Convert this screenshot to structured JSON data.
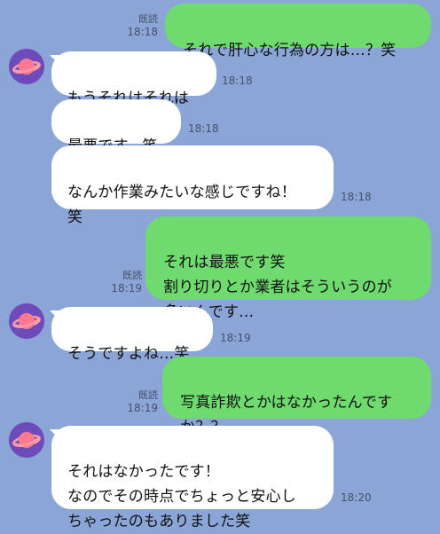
{
  "chat": {
    "messages": [
      {
        "side": "out",
        "text": "それで肝心な行為の方は…？笑",
        "read": "既読",
        "time": "18:18"
      },
      {
        "side": "in",
        "text": "もうそれはそれは",
        "time": "18:18"
      },
      {
        "side": "in",
        "text": "最悪です。笑",
        "time": "18:18"
      },
      {
        "side": "in",
        "text": "なんか作業みたいな感じですね！\n笑",
        "time": "18:18"
      },
      {
        "side": "out",
        "text": "それは最悪です笑\n割り切りとか業者はそういうのが\n多いんです…",
        "read": "既読",
        "time": "18:19"
      },
      {
        "side": "in",
        "text": "そうですよね…笑",
        "time": "18:19"
      },
      {
        "side": "out",
        "text": "写真詐欺とかはなかったんです\nか？？",
        "read": "既読",
        "time": "18:19"
      },
      {
        "side": "in",
        "text": "それはなかったです！\nなのでその時点でちょっと安心し\nちゃったのもありました笑",
        "time": "18:20"
      }
    ]
  },
  "colors": {
    "background": "#8aa5d6",
    "outgoing_bubble": "#6fdb6f",
    "incoming_bubble": "#ffffff",
    "avatar": "#6d4bbb"
  },
  "icons": {
    "avatar": "planet-icon"
  }
}
